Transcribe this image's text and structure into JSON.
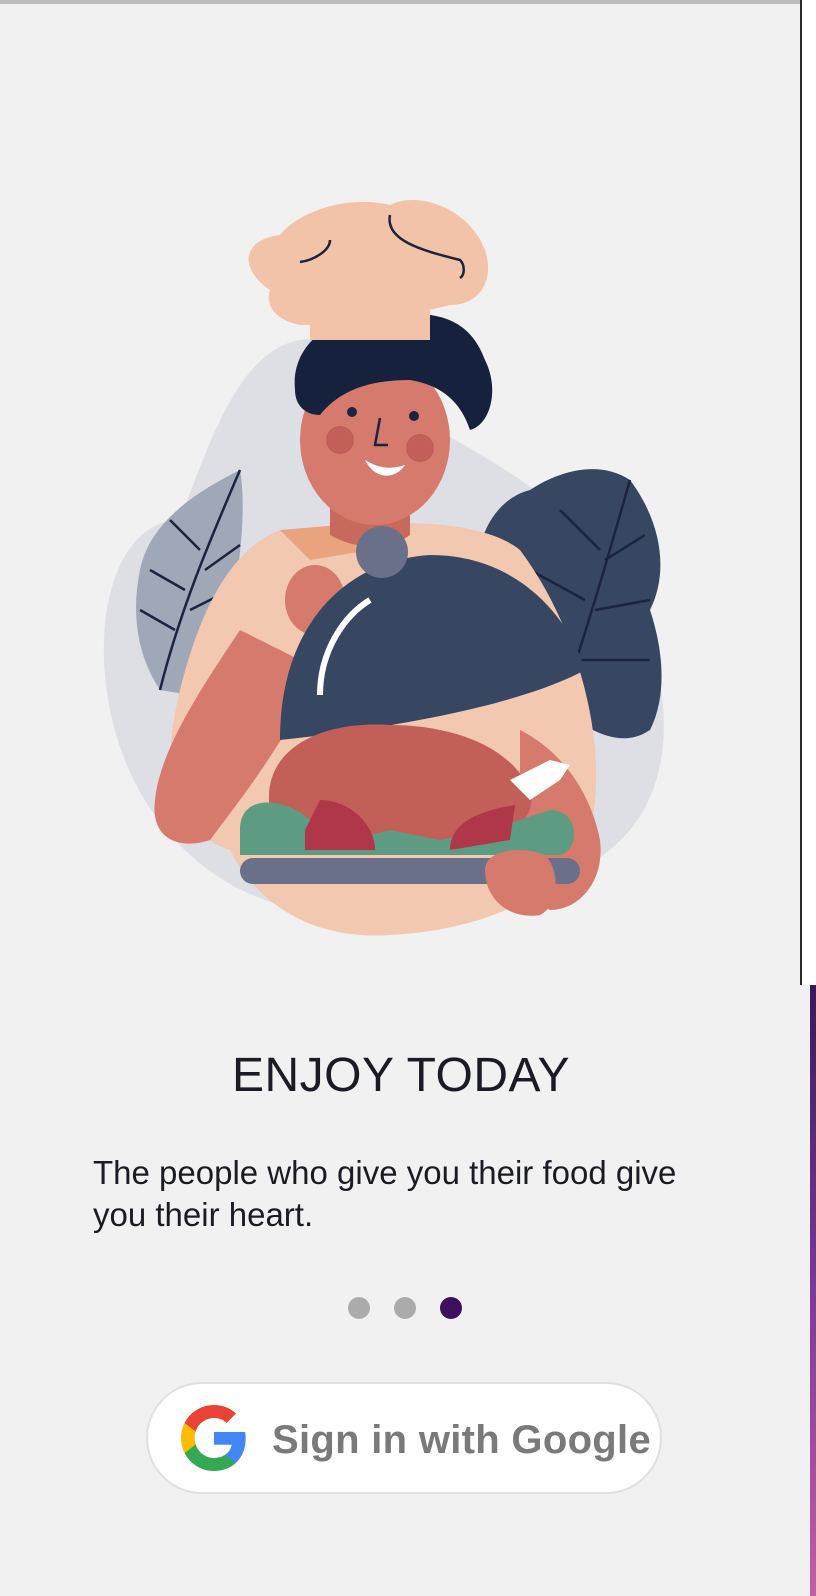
{
  "onboarding": {
    "title": "ENJOY TODAY",
    "subtitle": "The people who give you their food give you their heart.",
    "pages_total": 3,
    "active_page": 3
  },
  "signin": {
    "label": "Sign in with Google",
    "icon": "google-g-icon"
  },
  "colors": {
    "background": "#f2f1f1",
    "title": "#1b1b26",
    "dot_inactive": "#ababab",
    "dot_active": "#3d0f5c",
    "button_text": "#7a7a7a"
  },
  "illustration": {
    "subject": "chef-holding-roast-turkey-illustration"
  }
}
